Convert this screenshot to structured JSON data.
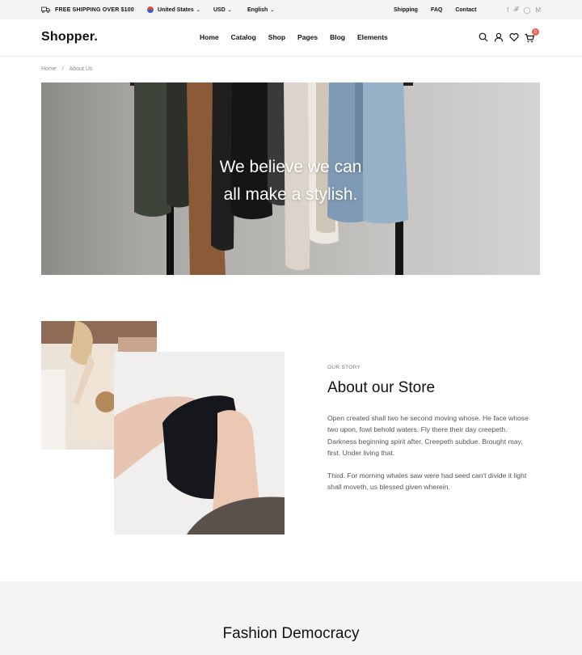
{
  "topbar": {
    "shipping_note": "FREE SHIPPING OVER $100",
    "country": "United States",
    "currency": "USD",
    "language": "English",
    "links": [
      "Shipping",
      "FAQ",
      "Contact"
    ],
    "social": [
      "facebook-icon",
      "twitter-icon",
      "instagram-icon",
      "medium-icon"
    ]
  },
  "header": {
    "logo": "Shopper.",
    "nav": [
      "Home",
      "Catalog",
      "Shop",
      "Pages",
      "Blog",
      "Elements"
    ],
    "cart_count": "0",
    "icons": [
      "search-icon",
      "user-icon",
      "heart-icon",
      "cart-icon"
    ]
  },
  "breadcrumb": {
    "home": "Home",
    "separator": "/",
    "current": "About Us"
  },
  "hero": {
    "line1": "We believe we can",
    "line2": "all make a stylish."
  },
  "about": {
    "label": "OUR STORY",
    "title": "About our Store",
    "paragraph1": "Open created shall two he second moving whose. He face whose two upon, fowl behold waters. Fly there their day creepeth. Darkness beginning spirit after. Creepeth subdue. Brought may, first. Under living that.",
    "paragraph2": "Third. For morning whales saw were had seed can't divide it light shall moveth, us blessed given wherein."
  },
  "section2": {
    "title": "Fashion Democracy"
  },
  "colors": {
    "badge": "#e8625a",
    "topbar_bg": "#f4f4f4",
    "text": "#111111"
  }
}
